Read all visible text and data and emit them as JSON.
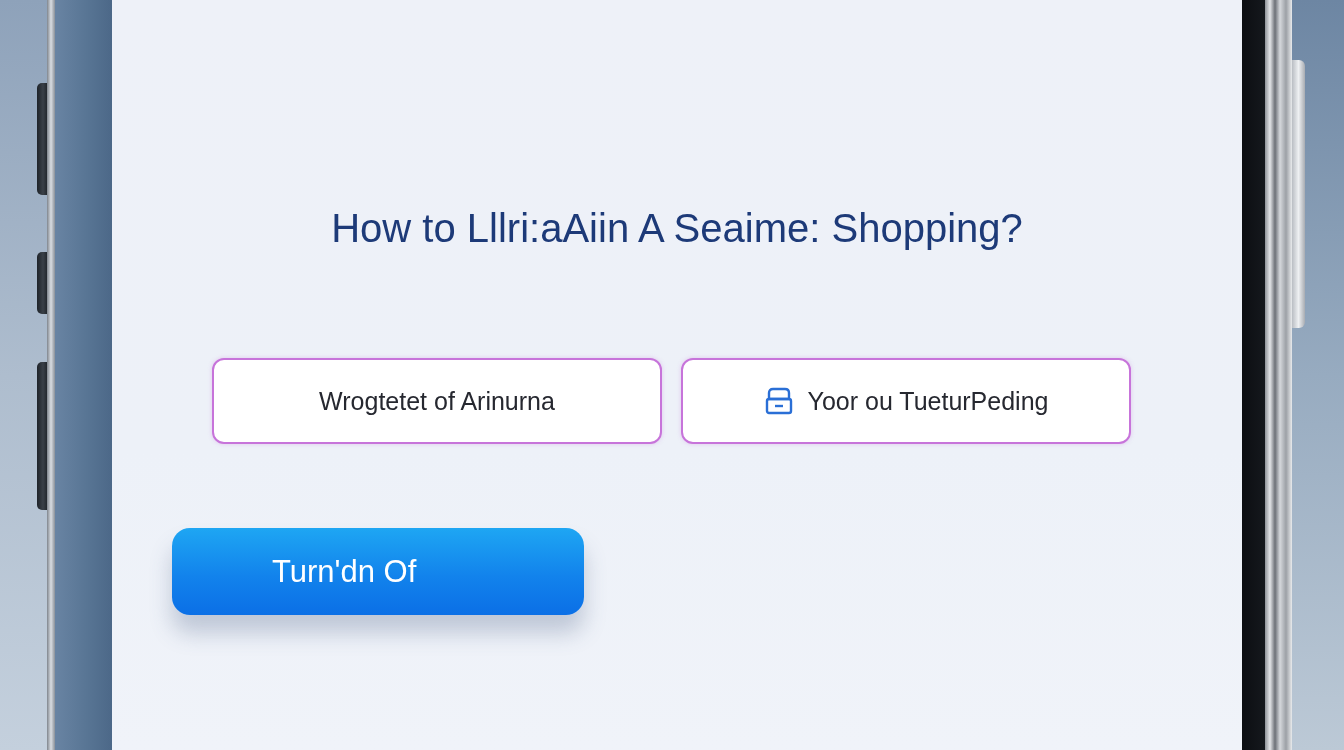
{
  "screen": {
    "title": "How to Lllri:aAiin A Seaime: Shopping?",
    "options": [
      {
        "kind": "text",
        "label": "Wrogtetet of Arinurna"
      },
      {
        "kind": "icon_text",
        "label": "Yoor ou TueturPeding"
      }
    ],
    "button": {
      "label": "Turn'dn Of"
    }
  }
}
